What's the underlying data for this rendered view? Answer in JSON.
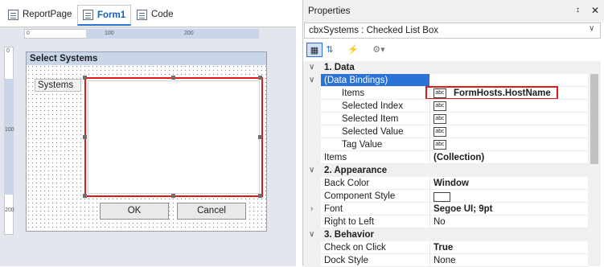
{
  "tabs": [
    {
      "label": "ReportPage",
      "icon": "report-page-icon"
    },
    {
      "label": "Form1",
      "icon": "form-icon"
    },
    {
      "label": "Code",
      "icon": "code-icon"
    }
  ],
  "ruler": {
    "h_ticks": [
      "0",
      "100",
      "200"
    ],
    "v_ticks": [
      "0",
      "100",
      "200"
    ]
  },
  "form": {
    "title": "Select Systems",
    "label": "Systems",
    "ok_label": "OK",
    "cancel_label": "Cancel"
  },
  "properties": {
    "title": "Properties",
    "pin": "↕",
    "close": "✕",
    "selector_text": "cbxSystems : Checked List Box",
    "rows": [
      {
        "kind": "cat",
        "name": "1. Data"
      },
      {
        "kind": "bind",
        "name": "(Data Bindings)"
      },
      {
        "kind": "sub",
        "name": "Items",
        "value": "FormHosts.HostName"
      },
      {
        "kind": "sub",
        "name": "Selected Index",
        "value": ""
      },
      {
        "kind": "sub",
        "name": "Selected Item",
        "value": ""
      },
      {
        "kind": "sub",
        "name": "Selected Value",
        "value": ""
      },
      {
        "kind": "sub",
        "name": "Tag Value",
        "value": ""
      },
      {
        "kind": "prop",
        "name": "Items",
        "value": "(Collection)"
      },
      {
        "kind": "cat",
        "name": "2. Appearance"
      },
      {
        "kind": "prop",
        "name": "Back Color",
        "value": "Window"
      },
      {
        "kind": "prop",
        "name": "Component Style",
        "value": ""
      },
      {
        "kind": "prop",
        "name": "Font",
        "value": "Segoe UI; 9pt"
      },
      {
        "kind": "prop",
        "name": "Right to Left",
        "value": "No"
      },
      {
        "kind": "cat",
        "name": "3. Behavior"
      },
      {
        "kind": "prop",
        "name": "Check on Click",
        "value": "True"
      },
      {
        "kind": "prop",
        "name": "Dock Style",
        "value": "None"
      }
    ],
    "abc_icon_text": "abc"
  },
  "colors": {
    "accent": "#2b72d6",
    "selection_red": "#e01919",
    "binding_row": "#2b72d6"
  }
}
